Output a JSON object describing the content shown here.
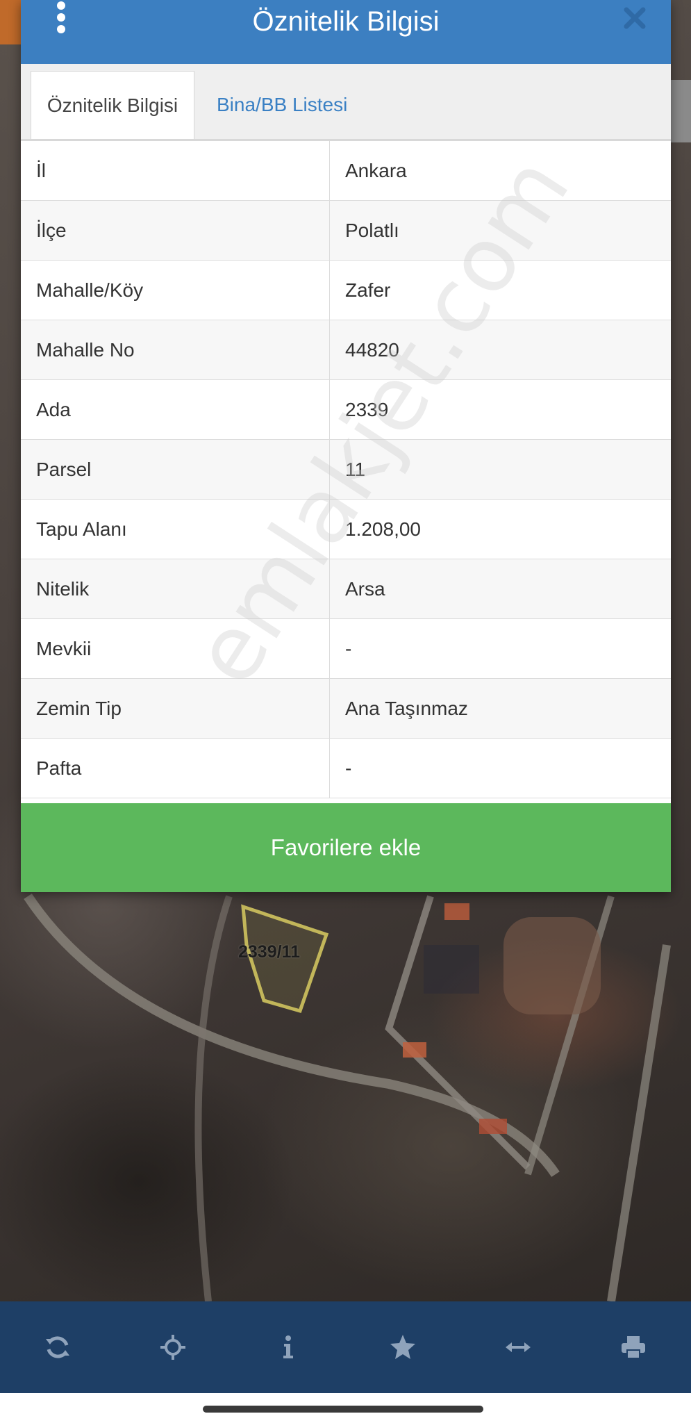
{
  "dialog": {
    "title": "Öznitelik Bilgisi",
    "header_color": "#3c7fc1",
    "icons": {
      "menu": "more-vertical-icon",
      "close": "close-icon"
    }
  },
  "tabs": [
    {
      "label": "Öznitelik Bilgisi",
      "active": true
    },
    {
      "label": "Bina/BB Listesi",
      "active": false
    }
  ],
  "attributes": [
    {
      "key": "İl",
      "value": "Ankara"
    },
    {
      "key": "İlçe",
      "value": "Polatlı"
    },
    {
      "key": "Mahalle/Köy",
      "value": "Zafer"
    },
    {
      "key": "Mahalle No",
      "value": "44820"
    },
    {
      "key": "Ada",
      "value": "2339"
    },
    {
      "key": "Parsel",
      "value": "11"
    },
    {
      "key": "Tapu Alanı",
      "value": "1.208,00"
    },
    {
      "key": "Nitelik",
      "value": "Arsa"
    },
    {
      "key": "Mevkii",
      "value": "-"
    },
    {
      "key": "Zemin Tip",
      "value": "Ana Taşınmaz"
    },
    {
      "key": "Pafta",
      "value": "-"
    }
  ],
  "favorite_button": {
    "label": "Favorilere ekle",
    "color": "#5cb85c"
  },
  "watermark": "emlakjet.com",
  "map": {
    "parcel_label": "2339/11"
  },
  "toolbar": {
    "color": "#1e3f66",
    "items": [
      "refresh-icon",
      "locate-icon",
      "info-icon",
      "star-icon",
      "measure-icon",
      "print-icon"
    ]
  }
}
